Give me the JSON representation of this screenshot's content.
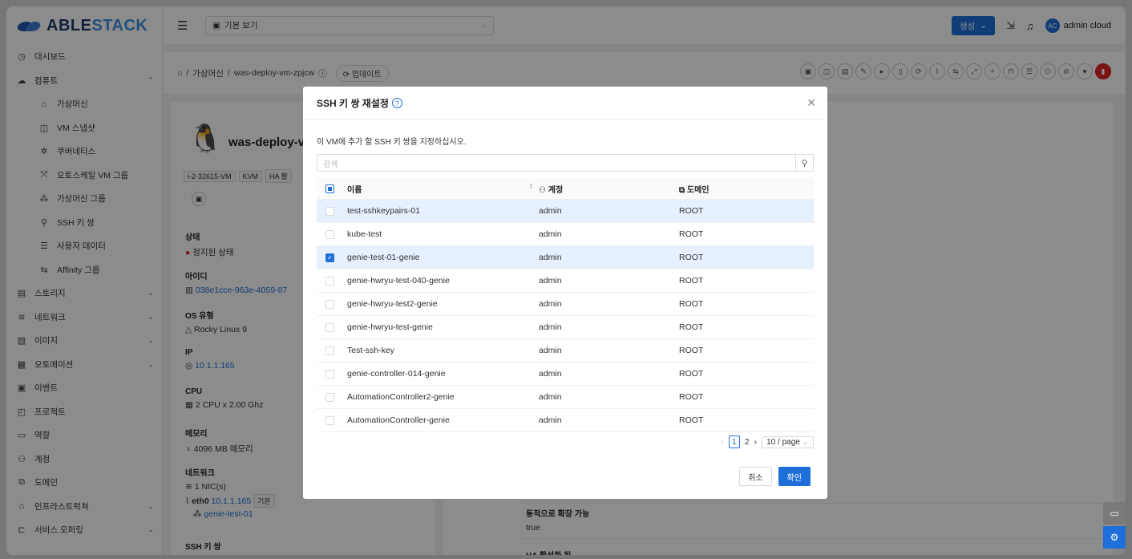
{
  "brand": {
    "part1": "ABLE",
    "part2": "STACK"
  },
  "topbar": {
    "view_label": "기본 보기",
    "create_label": "생성",
    "avatar_initials": "AC",
    "user_name": "admin cloud"
  },
  "sidebar": {
    "items": [
      {
        "label": "대시보드",
        "icon": "dashboard-icon",
        "glyph": "◷",
        "sub": false
      },
      {
        "label": "컴퓨트",
        "icon": "cloud-icon",
        "glyph": "☁",
        "sub": false,
        "chev": "⌃"
      },
      {
        "label": "가상머신",
        "icon": "cloud-server-icon",
        "glyph": "⌂",
        "sub": true
      },
      {
        "label": "VM 스냅샷",
        "icon": "camera-icon",
        "glyph": "◫",
        "sub": true
      },
      {
        "label": "쿠버네티스",
        "icon": "kubernetes-icon",
        "glyph": "✲",
        "sub": true
      },
      {
        "label": "오토스케일 VM 그룹",
        "icon": "autoscale-icon",
        "glyph": "⤧",
        "sub": true
      },
      {
        "label": "가상머신 그룹",
        "icon": "cluster-icon",
        "glyph": "⁂",
        "sub": true
      },
      {
        "label": "SSH 키 쌍",
        "icon": "key-icon",
        "glyph": "⚲",
        "sub": true
      },
      {
        "label": "사용자 데이터",
        "icon": "solution-icon",
        "glyph": "☰",
        "sub": true
      },
      {
        "label": "Affinity 그룹",
        "icon": "swap-icon",
        "glyph": "⇆",
        "sub": true
      },
      {
        "label": "스토리지",
        "icon": "storage-icon",
        "glyph": "▤",
        "sub": false,
        "chev": "⌄"
      },
      {
        "label": "네트워크",
        "icon": "wifi-icon",
        "glyph": "≋",
        "sub": false,
        "chev": "⌄"
      },
      {
        "label": "이미지",
        "icon": "picture-icon",
        "glyph": "▨",
        "sub": false,
        "chev": "⌄"
      },
      {
        "label": "오토메이션",
        "icon": "apps-icon",
        "glyph": "▦",
        "sub": false,
        "chev": "⌄"
      },
      {
        "label": "이벤트",
        "icon": "calendar-icon",
        "glyph": "▣",
        "sub": false
      },
      {
        "label": "프로젝트",
        "icon": "project-icon",
        "glyph": "◰",
        "sub": false
      },
      {
        "label": "역할",
        "icon": "idcard-icon",
        "glyph": "▭",
        "sub": false
      },
      {
        "label": "계정",
        "icon": "team-icon",
        "glyph": "⚇",
        "sub": false
      },
      {
        "label": "도메인",
        "icon": "block-icon",
        "glyph": "⧉",
        "sub": false
      },
      {
        "label": "인프라스트럭쳐",
        "icon": "bank-icon",
        "glyph": "⌂",
        "sub": false,
        "chev": "⌄"
      },
      {
        "label": "서비스 오퍼링",
        "icon": "shopping-icon",
        "glyph": "⊏",
        "sub": false,
        "chev": "⌄"
      }
    ]
  },
  "breadcrumb": {
    "root": "가상머신",
    "current": "was-deploy-vm-zpjcw",
    "refresh_label": "업데이트"
  },
  "vm": {
    "name": "was-deploy-vm-",
    "tags": [
      "i-2-32615-VM",
      "KVM",
      "HA 활"
    ],
    "state_label": "상태",
    "state_value": "정지된 상태",
    "id_label": "아이디",
    "id_value": "038e1cce-963e-4059-87",
    "os_label": "OS 유형",
    "os_value": "Rocky Linux 9",
    "ip_label": "IP",
    "ip_value": "10.1.1.165",
    "cpu_label": "CPU",
    "cpu_value": "2 CPU x 2.00 Ghz",
    "mem_label": "메모리",
    "mem_value": "4096 MB 메모리",
    "net_label": "네트워크",
    "net_nics": "1 NIC(s)",
    "net_iface": "eth0",
    "net_ip": "10.1.1.165",
    "net_default": "기본",
    "net_name": "genie-test-01",
    "ssh_label": "SSH 키 쌍"
  },
  "right_panel": {
    "scalable_label": "동적으로 확장 가능",
    "scalable_value": "true",
    "ha_label": "HA 활성화 됨"
  },
  "modal": {
    "title": "SSH 키 쌍 재설정",
    "description": "이 VM에 추가 할 SSH 키 쌍을 지정하십시오.",
    "search_placeholder": "검색",
    "columns": {
      "name": "이름",
      "account": "계정",
      "domain": "도메인"
    },
    "rows": [
      {
        "name": "test-sshkeypairs-01",
        "account": "admin",
        "domain": "ROOT",
        "checked": false,
        "highlight": true
      },
      {
        "name": "kube-test",
        "account": "admin",
        "domain": "ROOT",
        "checked": false,
        "highlight": false
      },
      {
        "name": "genie-test-01-genie",
        "account": "admin",
        "domain": "ROOT",
        "checked": true,
        "highlight": true
      },
      {
        "name": "genie-hwryu-test-040-genie",
        "account": "admin",
        "domain": "ROOT",
        "checked": false,
        "highlight": false
      },
      {
        "name": "genie-hwryu-test2-genie",
        "account": "admin",
        "domain": "ROOT",
        "checked": false,
        "highlight": false
      },
      {
        "name": "genie-hwryu-test-genie",
        "account": "admin",
        "domain": "ROOT",
        "checked": false,
        "highlight": false
      },
      {
        "name": "Test-ssh-key",
        "account": "admin",
        "domain": "ROOT",
        "checked": false,
        "highlight": false
      },
      {
        "name": "genie-controller-014-genie",
        "account": "admin",
        "domain": "ROOT",
        "checked": false,
        "highlight": false
      },
      {
        "name": "AutomationController2-genie",
        "account": "admin",
        "domain": "ROOT",
        "checked": false,
        "highlight": false
      },
      {
        "name": "AutomationController-genie",
        "account": "admin",
        "domain": "ROOT",
        "checked": false,
        "highlight": false
      }
    ],
    "pagination": {
      "current": "1",
      "next": "2",
      "page_size": "10 / page"
    },
    "cancel_label": "취소",
    "ok_label": "확인"
  }
}
